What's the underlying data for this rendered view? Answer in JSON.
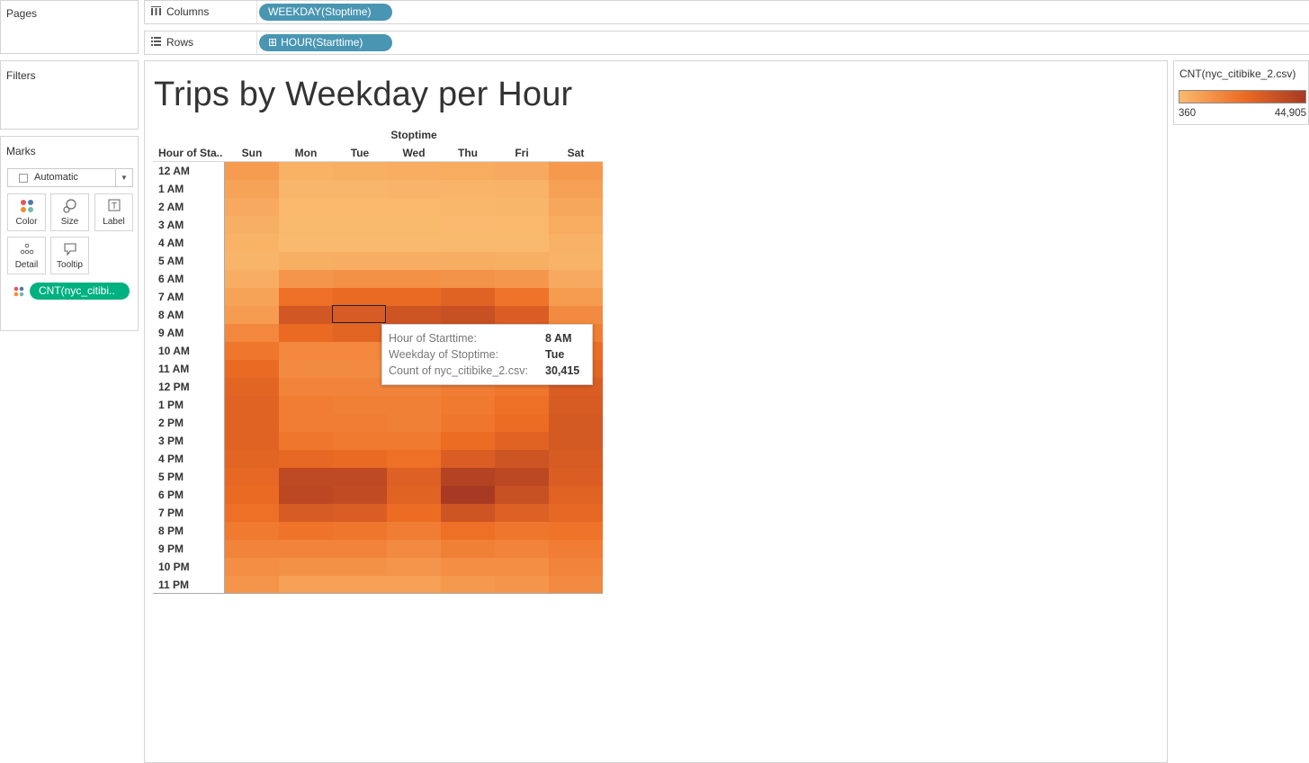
{
  "panes": {
    "pages_title": "Pages",
    "filters_title": "Filters",
    "marks_title": "Marks"
  },
  "shelves": {
    "columns_label": "Columns",
    "columns_pill": "WEEKDAY(Stoptime)",
    "rows_label": "Rows",
    "rows_pill": "HOUR(Starttime)",
    "rows_pill_icon": "⊞"
  },
  "marks": {
    "type": "Automatic",
    "buttons": [
      "Color",
      "Size",
      "Label",
      "Detail",
      "Tooltip"
    ],
    "field_pill": "CNT(nyc_citibi.."
  },
  "view": {
    "title": "Trips by Weekday per Hour",
    "col_group_header": "Stoptime",
    "row_header": "Hour of Sta.."
  },
  "legend": {
    "title": "CNT(nyc_citibike_2.csv)",
    "min_label": "360",
    "max_label": "44,905",
    "color_low": "#f9ba6e",
    "color_mid": "#ee6d24",
    "color_high": "#a83a23"
  },
  "tooltip": {
    "rows": [
      {
        "key": "Hour of Starttime:",
        "value": "8 AM"
      },
      {
        "key": "Weekday of Stoptime:",
        "value": "Tue"
      },
      {
        "key": "Count of nyc_citibike_2.csv:",
        "value": "30,415"
      }
    ]
  },
  "chart_data": {
    "type": "heatmap",
    "title": "Trips by Weekday per Hour",
    "x_title": "Stoptime",
    "y_title": "Hour of Sta..",
    "x": [
      "Sun",
      "Mon",
      "Tue",
      "Wed",
      "Thu",
      "Fri",
      "Sat"
    ],
    "y": [
      "12 AM",
      "1 AM",
      "2 AM",
      "3 AM",
      "4 AM",
      "5 AM",
      "6 AM",
      "7 AM",
      "8 AM",
      "9 AM",
      "10 AM",
      "11 AM",
      "12 PM",
      "1 PM",
      "2 PM",
      "3 PM",
      "4 PM",
      "5 PM",
      "6 PM",
      "7 PM",
      "8 PM",
      "9 PM",
      "10 PM",
      "11 PM"
    ],
    "color_range": [
      360,
      44905
    ],
    "values": [
      [
        9000,
        3000,
        3500,
        4000,
        4500,
        5000,
        10000
      ],
      [
        7000,
        1500,
        1500,
        1800,
        2000,
        2500,
        8000
      ],
      [
        5000,
        900,
        900,
        1000,
        1200,
        1500,
        6000
      ],
      [
        3500,
        600,
        600,
        700,
        800,
        900,
        4500
      ],
      [
        2500,
        500,
        500,
        500,
        600,
        700,
        3000
      ],
      [
        2000,
        3500,
        3800,
        3800,
        3700,
        3500,
        2500
      ],
      [
        4000,
        11000,
        12000,
        12000,
        11500,
        10500,
        5000
      ],
      [
        7000,
        22000,
        24000,
        24000,
        27000,
        21000,
        9000
      ],
      [
        9000,
        32000,
        30415,
        33000,
        35000,
        29000,
        14000
      ],
      [
        15000,
        24000,
        26000,
        26000,
        27000,
        22000,
        18000
      ],
      [
        20000,
        15000,
        15000,
        16000,
        17000,
        16000,
        23000
      ],
      [
        24000,
        14000,
        14000,
        15000,
        16000,
        17000,
        26000
      ],
      [
        26000,
        16000,
        16000,
        16000,
        18000,
        20000,
        29000
      ],
      [
        27000,
        18000,
        17000,
        17000,
        19000,
        22000,
        30000
      ],
      [
        27000,
        18000,
        18000,
        17000,
        20000,
        23000,
        31000
      ],
      [
        27000,
        20000,
        19000,
        19000,
        23000,
        27000,
        31000
      ],
      [
        26000,
        25000,
        24000,
        22000,
        29000,
        33000,
        30000
      ],
      [
        25000,
        38000,
        38000,
        28000,
        41000,
        39000,
        29000
      ],
      [
        24000,
        39000,
        37000,
        27000,
        44905,
        35000,
        27000
      ],
      [
        22000,
        30000,
        29000,
        23000,
        33000,
        28000,
        25000
      ],
      [
        19000,
        21000,
        20000,
        18000,
        22000,
        20000,
        21000
      ],
      [
        16000,
        16000,
        16000,
        14000,
        17000,
        16000,
        18000
      ],
      [
        13000,
        12000,
        12000,
        11000,
        13000,
        13000,
        16000
      ],
      [
        11000,
        8000,
        8000,
        8000,
        10000,
        11000,
        14000
      ]
    ]
  }
}
